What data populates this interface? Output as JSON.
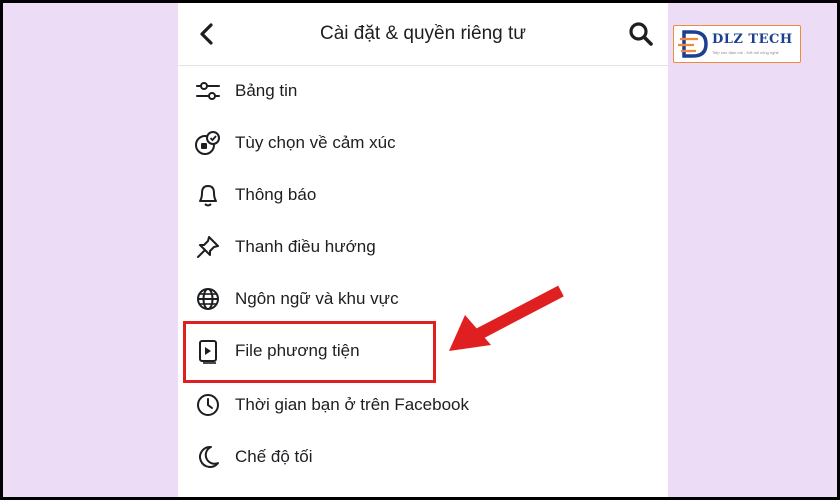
{
  "header": {
    "title": "Cài đặt & quyền riêng tư"
  },
  "menu": [
    {
      "label": "Bảng tin",
      "icon": "sliders-icon"
    },
    {
      "label": "Tùy chọn về cảm xúc",
      "icon": "reactions-icon"
    },
    {
      "label": "Thông báo",
      "icon": "bell-icon"
    },
    {
      "label": "Thanh điều hướng",
      "icon": "pin-icon"
    },
    {
      "label": "Ngôn ngữ và khu vực",
      "icon": "globe-icon"
    },
    {
      "label": "File phương tiện",
      "icon": "media-file-icon"
    },
    {
      "label": "Thời gian bạn ở trên Facebook",
      "icon": "clock-icon"
    },
    {
      "label": "Chế độ tối",
      "icon": "moon-icon"
    }
  ],
  "logo": {
    "name": "DLZ TECH",
    "tagline": "Tiếp sức đam mê - Kết nối công nghệ"
  },
  "colors": {
    "highlight": "#e02020",
    "background": "#ecdcf5",
    "logo_blue": "#1d3f8f",
    "logo_orange": "#ef8a3c"
  }
}
